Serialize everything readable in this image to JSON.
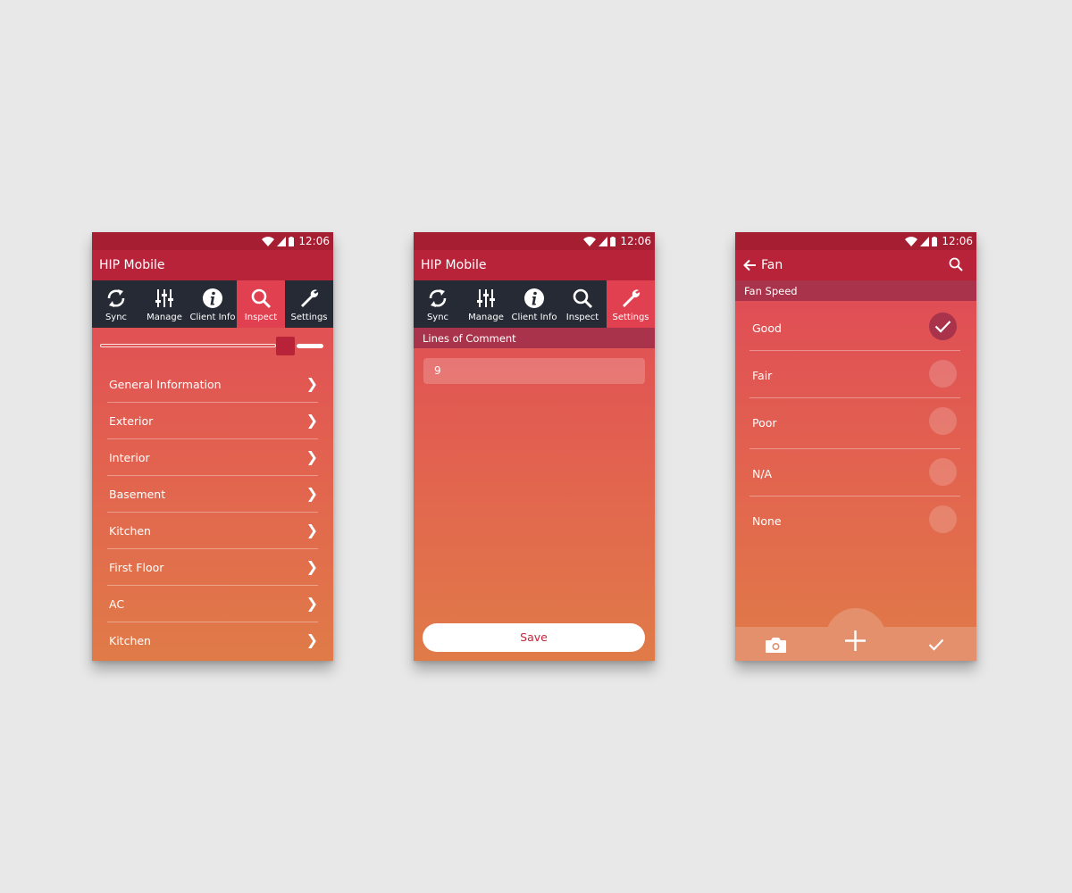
{
  "status": {
    "time": "12:06"
  },
  "app": {
    "title": "HIP Mobile"
  },
  "tabs": [
    {
      "label": "Sync",
      "icon": "sync-icon"
    },
    {
      "label": "Manage",
      "icon": "sliders-icon"
    },
    {
      "label": "Client Info",
      "icon": "info-icon"
    },
    {
      "label": "Inspect",
      "icon": "search-icon"
    },
    {
      "label": "Settings",
      "icon": "wrench-icon"
    }
  ],
  "screen1": {
    "active_tab": "Inspect",
    "slider_value": 0.86,
    "menu_items": [
      "General Information",
      "Exterior",
      "Interior",
      "Basement",
      "Kitchen",
      "First Floor",
      "AC",
      "Kitchen"
    ],
    "chevron": "❯"
  },
  "screen2": {
    "active_tab": "Settings",
    "section_label": "Lines of Comment",
    "lines_value": "9",
    "save_label": "Save"
  },
  "screen3": {
    "title": "Fan",
    "section_label": "Fan Speed",
    "options": [
      {
        "label": "Good",
        "checked": true
      },
      {
        "label": "Fair",
        "checked": false
      },
      {
        "label": "Poor",
        "checked": false
      },
      {
        "label": "N/A",
        "checked": false
      },
      {
        "label": "None",
        "checked": false
      }
    ]
  },
  "colors": {
    "status_bar": "#a51e32",
    "app_bar": "#b8233a",
    "tab_bar": "#252a35",
    "active_tab": "#e0404f",
    "gradient_top": "#df4558",
    "gradient_bottom": "#e07b48",
    "bottom_bar": "#e4906c"
  }
}
